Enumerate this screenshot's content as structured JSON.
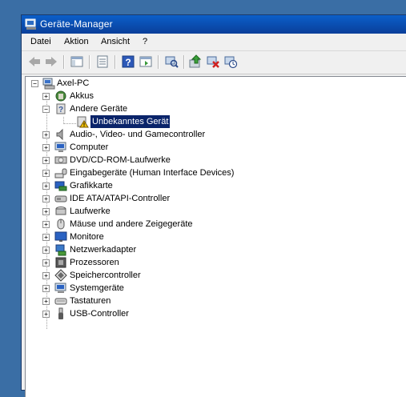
{
  "window": {
    "title": "Geräte-Manager"
  },
  "menu": {
    "datei": "Datei",
    "aktion": "Aktion",
    "ansicht": "Ansicht",
    "hilfe": "?"
  },
  "toolbar": {
    "icons": [
      "back-icon",
      "forward-icon",
      "show-hide-console-tree-icon",
      "properties-icon",
      "help-icon",
      "action-pane-icon",
      "scan-hardware-icon",
      "update-driver-icon",
      "uninstall-icon",
      "disable-icon"
    ]
  },
  "tree": {
    "root": "Axel-PC",
    "akkus": "Akkus",
    "andere_geraete": "Andere Geräte",
    "unbekanntes_geraet": "Unbekanntes Gerät",
    "audio": "Audio-, Video- und Gamecontroller",
    "computer": "Computer",
    "dvd": "DVD/CD-ROM-Laufwerke",
    "eingabe": "Eingabegeräte (Human Interface Devices)",
    "grafik": "Grafikkarte",
    "ide": "IDE ATA/ATAPI-Controller",
    "laufwerke": "Laufwerke",
    "maeuse": "Mäuse und andere Zeigegeräte",
    "monitore": "Monitore",
    "netzwerk": "Netzwerkadapter",
    "prozessoren": "Prozessoren",
    "speicher": "Speichercontroller",
    "system": "Systemgeräte",
    "tastaturen": "Tastaturen",
    "usb": "USB-Controller"
  },
  "colors": {
    "titlebar": "#0a4fb5",
    "selection": "#0a246a",
    "desktop": "#3a6ea5"
  }
}
